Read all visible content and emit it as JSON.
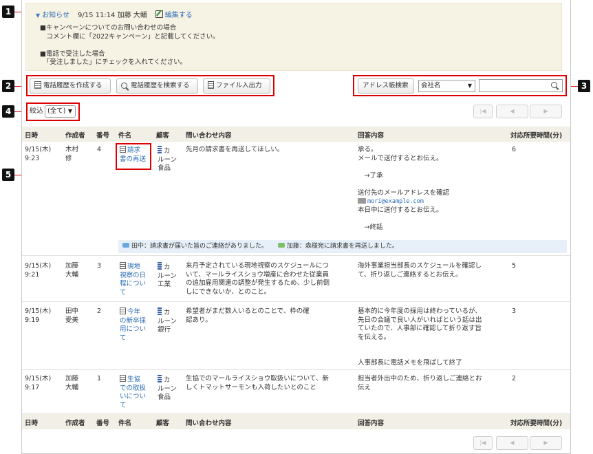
{
  "callouts": [
    "1",
    "2",
    "3",
    "4",
    "5"
  ],
  "notice": {
    "title": "お知らせ",
    "meta": "9/15 11:14 加藤 大輔",
    "edit_label": "編集する",
    "body": "■キャンペーンについてのお問い合わせの場合\n　コメント欄に「2022キャンペーン」と記載してください。\n\n■電話で受注した場合\n　「受注しました」にチェックを入れてください。"
  },
  "toolbar": {
    "create_label": "電話履歴を作成する",
    "search_label": "電話履歴を検索する",
    "file_label": "ファイル入出力"
  },
  "address": {
    "button_label": "アドレス帳検索",
    "field_select": "会社名",
    "input_value": ""
  },
  "filter": {
    "label": "絞込",
    "selected": "(全て)"
  },
  "pager": {
    "first": "|◀",
    "prev": "◀",
    "next": "▶"
  },
  "columns": {
    "date": "日時",
    "author": "作成者",
    "number": "番号",
    "subject": "件名",
    "customer": "顧客",
    "inquiry": "問い合わせ内容",
    "answer": "回答内容",
    "minutes": "対応所要時間(分)"
  },
  "rows": [
    {
      "date": "9/15(木)\n9:23",
      "author": "木村\n修",
      "number": "4",
      "subject": "請求\n書の再送",
      "customer": "カ\nルーン\n食品",
      "inquiry": "先月の請求書を再送してほしい。",
      "answer_top": "承る。\nメールで送付するとお伝え。\n\n　→了承\n\n送付先のメールアドレスを確認",
      "answer_email": "mori@example.com",
      "answer_bottom": "本日中に送付するとお伝え。\n\n　→終話",
      "minutes": "6"
    },
    {
      "date": "9/15(木)\n9:21",
      "author": "加藤\n大輔",
      "number": "3",
      "subject": "現地\n視察の日\n程につい\nて",
      "customer": "カ\nルーン\n工業",
      "inquiry": "来月予定されている現地視察のスケジュールにつ\nいて、マールライスショウ増産に合わせた従業員\nの追加雇用関連の調整が発生するため、少し前倒\nしにできないか、とのこと。",
      "answer": "海外事業担当部長のスケジュールを確認し\nて、折り返しご連絡するとお伝え。",
      "minutes": "5"
    },
    {
      "date": "9/15(木)\n9:19",
      "author": "田中\n愛美",
      "number": "2",
      "subject": "今年\nの新卒採\n用につい\nて",
      "customer": "カ\nルーン\n銀行",
      "inquiry": "希望者がまだ数人いるとのことで、枠の確\n認あり。",
      "answer": "基本的に今年度の採用は終わっているが、\n先日の会議で良い人がいればという話は出\nていたので、人事部に確認して折り返す旨\nを伝える。\n\n\n人事部長に電話メモを飛ばして終了",
      "minutes": "3"
    },
    {
      "date": "9/15(木)\n9:17",
      "author": "加藤\n大輔",
      "number": "1",
      "subject": "生協\nでの取扱\nいについ\nて",
      "customer": "カ\nルーン\n食品",
      "inquiry": "生協でのマールライスショウ取扱いについて、新\nしくトマットサーモンも入荷したいとのこと",
      "answer": "担当者外出中のため、折り返しご連絡とお\n伝え",
      "minutes": "2"
    }
  ],
  "comments": {
    "first": "田中：請求書が届いた旨のご連絡がありました。",
    "second": "加藤：森様宛に請求書を再送しました。"
  },
  "colors": {
    "accent": "#2a6cb5",
    "callout_border": "#dd0000",
    "notice_bg": "#f6f2e4",
    "header_bg": "#f2efe6",
    "comment_bg": "#e7f0f8"
  }
}
